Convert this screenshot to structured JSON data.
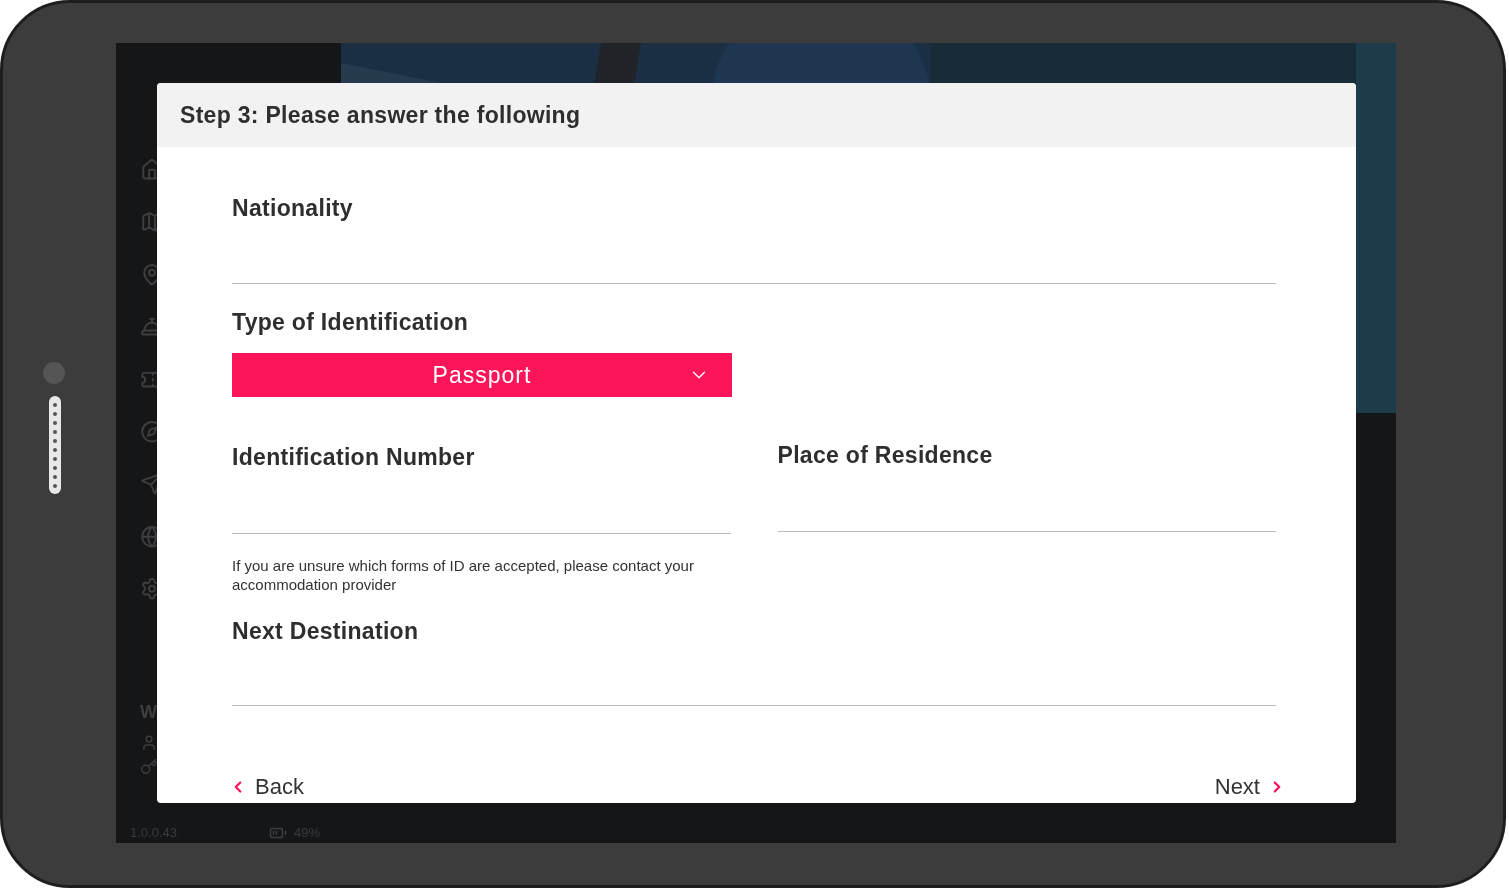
{
  "app_background": {
    "menu_letter": "W",
    "version": "1.0.0.43",
    "battery": "49%"
  },
  "dialog": {
    "title": "Step 3: Please answer the following",
    "nationality": {
      "label": "Nationality"
    },
    "id_type": {
      "label": "Type of Identification",
      "value": "Passport"
    },
    "id_number": {
      "label": "Identification Number",
      "hint": "If you are unsure which forms of ID are accepted, please contact your accommodation provider"
    },
    "residence": {
      "label": "Place of Residence"
    },
    "next_destination": {
      "label": "Next Destination"
    },
    "back": "Back",
    "next": "Next"
  }
}
